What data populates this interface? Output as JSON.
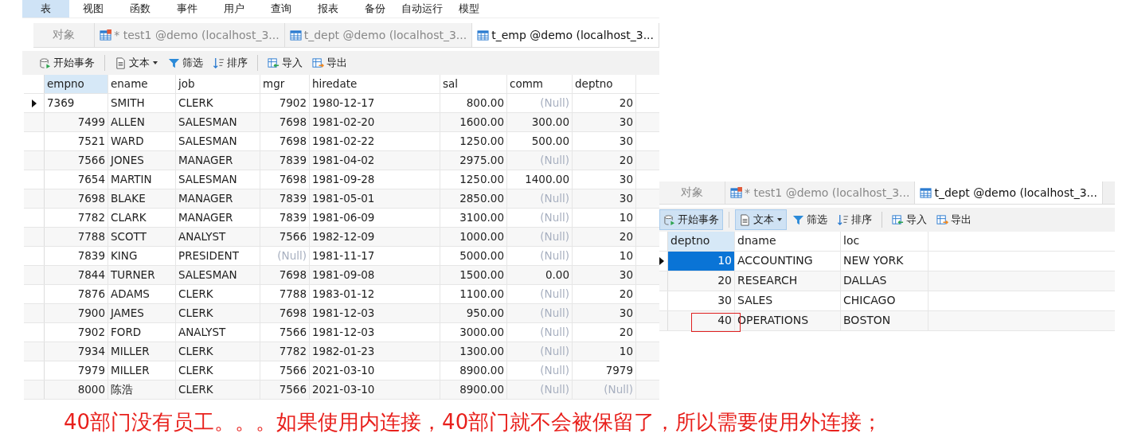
{
  "menu": [
    {
      "label": "表",
      "selected": true
    },
    {
      "label": "视图",
      "selected": false
    },
    {
      "label": "函数",
      "selected": false
    },
    {
      "label": "事件",
      "selected": false
    },
    {
      "label": "用户",
      "selected": false
    },
    {
      "label": "查询",
      "selected": false
    },
    {
      "label": "报表",
      "selected": false
    },
    {
      "label": "备份",
      "selected": false
    },
    {
      "label": "自动运行",
      "selected": false
    },
    {
      "label": "模型",
      "selected": false
    }
  ],
  "left_panel": {
    "tabs": [
      {
        "label": "对象",
        "kind": "plain",
        "selected": false
      },
      {
        "label": "* test1 @demo (localhost_3...",
        "kind": "query",
        "selected": false
      },
      {
        "label": "t_dept @demo (localhost_3...",
        "kind": "table",
        "selected": false
      },
      {
        "label": "t_emp @demo (localhost_3...",
        "kind": "table",
        "selected": true
      }
    ],
    "toolbar": [
      {
        "label": "开始事务",
        "kind": "transaction",
        "pressed": false
      },
      {
        "label": "文本",
        "kind": "text",
        "pressed": false
      },
      {
        "label": "筛选",
        "kind": "filter",
        "pressed": false
      },
      {
        "label": "排序",
        "kind": "sort",
        "pressed": false
      },
      {
        "label": "导入",
        "kind": "import",
        "pressed": false
      },
      {
        "label": "导出",
        "kind": "export",
        "pressed": false
      }
    ],
    "table": {
      "columns": [
        "empno",
        "ename",
        "job",
        "mgr",
        "hiredate",
        "sal",
        "comm",
        "deptno"
      ],
      "rows": [
        {
          "selected": true,
          "cells": [
            "7369",
            "SMITH",
            "CLERK",
            "7902",
            "1980-12-17",
            "800.00",
            {
              "text": "(Null)",
              "null": true
            },
            "20"
          ]
        },
        {
          "selected": false,
          "cells": [
            "7499",
            "ALLEN",
            "SALESMAN",
            "7698",
            "1981-02-20",
            "1600.00",
            "300.00",
            "30"
          ]
        },
        {
          "selected": false,
          "cells": [
            "7521",
            "WARD",
            "SALESMAN",
            "7698",
            "1981-02-22",
            "1250.00",
            "500.00",
            "30"
          ]
        },
        {
          "selected": false,
          "cells": [
            "7566",
            "JONES",
            "MANAGER",
            "7839",
            "1981-04-02",
            "2975.00",
            {
              "text": "(Null)",
              "null": true
            },
            "20"
          ]
        },
        {
          "selected": false,
          "cells": [
            "7654",
            "MARTIN",
            "SALESMAN",
            "7698",
            "1981-09-28",
            "1250.00",
            "1400.00",
            "30"
          ]
        },
        {
          "selected": false,
          "cells": [
            "7698",
            "BLAKE",
            "MANAGER",
            "7839",
            "1981-05-01",
            "2850.00",
            {
              "text": "(Null)",
              "null": true
            },
            "30"
          ]
        },
        {
          "selected": false,
          "cells": [
            "7782",
            "CLARK",
            "MANAGER",
            "7839",
            "1981-06-09",
            "3100.00",
            {
              "text": "(Null)",
              "null": true
            },
            "10"
          ]
        },
        {
          "selected": false,
          "cells": [
            "7788",
            "SCOTT",
            "ANALYST",
            "7566",
            "1982-12-09",
            "1000.00",
            {
              "text": "(Null)",
              "null": true
            },
            "20"
          ]
        },
        {
          "selected": false,
          "cells": [
            "7839",
            "KING",
            "PRESIDENT",
            {
              "text": "(Null)",
              "null": true
            },
            "1981-11-17",
            "5000.00",
            {
              "text": "(Null)",
              "null": true
            },
            "10"
          ]
        },
        {
          "selected": false,
          "cells": [
            "7844",
            "TURNER",
            "SALESMAN",
            "7698",
            "1981-09-08",
            "1500.00",
            "0.00",
            "30"
          ]
        },
        {
          "selected": false,
          "cells": [
            "7876",
            "ADAMS",
            "CLERK",
            "7788",
            "1983-01-12",
            "1100.00",
            {
              "text": "(Null)",
              "null": true
            },
            "20"
          ]
        },
        {
          "selected": false,
          "cells": [
            "7900",
            "JAMES",
            "CLERK",
            "7698",
            "1981-12-03",
            "950.00",
            {
              "text": "(Null)",
              "null": true
            },
            "30"
          ]
        },
        {
          "selected": false,
          "cells": [
            "7902",
            "FORD",
            "ANALYST",
            "7566",
            "1981-12-03",
            "3000.00",
            {
              "text": "(Null)",
              "null": true
            },
            "20"
          ]
        },
        {
          "selected": false,
          "cells": [
            "7934",
            "MILLER",
            "CLERK",
            "7782",
            "1982-01-23",
            "1300.00",
            {
              "text": "(Null)",
              "null": true
            },
            "10"
          ]
        },
        {
          "selected": false,
          "cells": [
            "7979",
            "MILLER",
            "CLERK",
            "7566",
            "2021-03-10",
            "8900.00",
            {
              "text": "(Null)",
              "null": true
            },
            "7979"
          ]
        },
        {
          "selected": false,
          "cells": [
            "8000",
            "陈浩",
            "CLERK",
            "7566",
            "2021-03-10",
            "8900.00",
            {
              "text": "(Null)",
              "null": true
            },
            {
              "text": "(Null)",
              "null": true
            }
          ]
        }
      ]
    }
  },
  "right_panel": {
    "tabs": [
      {
        "label": "对象",
        "kind": "plain",
        "selected": false
      },
      {
        "label": "* test1 @demo (localhost_3...",
        "kind": "query",
        "selected": false
      },
      {
        "label": "t_dept @demo (localhost_3...",
        "kind": "table",
        "selected": true
      }
    ],
    "toolbar": [
      {
        "label": "开始事务",
        "kind": "transaction",
        "pressed": true
      },
      {
        "label": "文本",
        "kind": "text",
        "pressed": true
      },
      {
        "label": "筛选",
        "kind": "filter",
        "pressed": false
      },
      {
        "label": "排序",
        "kind": "sort",
        "pressed": false
      },
      {
        "label": "导入",
        "kind": "import",
        "pressed": false
      },
      {
        "label": "导出",
        "kind": "export",
        "pressed": false
      }
    ],
    "table": {
      "columns": [
        "deptno",
        "dname",
        "loc"
      ],
      "rows": [
        {
          "selected": true,
          "highlighted": false,
          "cells": [
            "10",
            "ACCOUNTING",
            "NEW YORK"
          ]
        },
        {
          "selected": false,
          "highlighted": false,
          "cells": [
            "20",
            "RESEARCH",
            "DALLAS"
          ]
        },
        {
          "selected": false,
          "highlighted": false,
          "cells": [
            "30",
            "SALES",
            "CHICAGO"
          ]
        },
        {
          "selected": false,
          "highlighted": true,
          "cells": [
            "40",
            "OPERATIONS",
            "BOSTON"
          ]
        }
      ]
    }
  },
  "note": "40部门没有员工。。。如果使用内连接，40部门就不会被保留了，所以需要使用外连接；"
}
